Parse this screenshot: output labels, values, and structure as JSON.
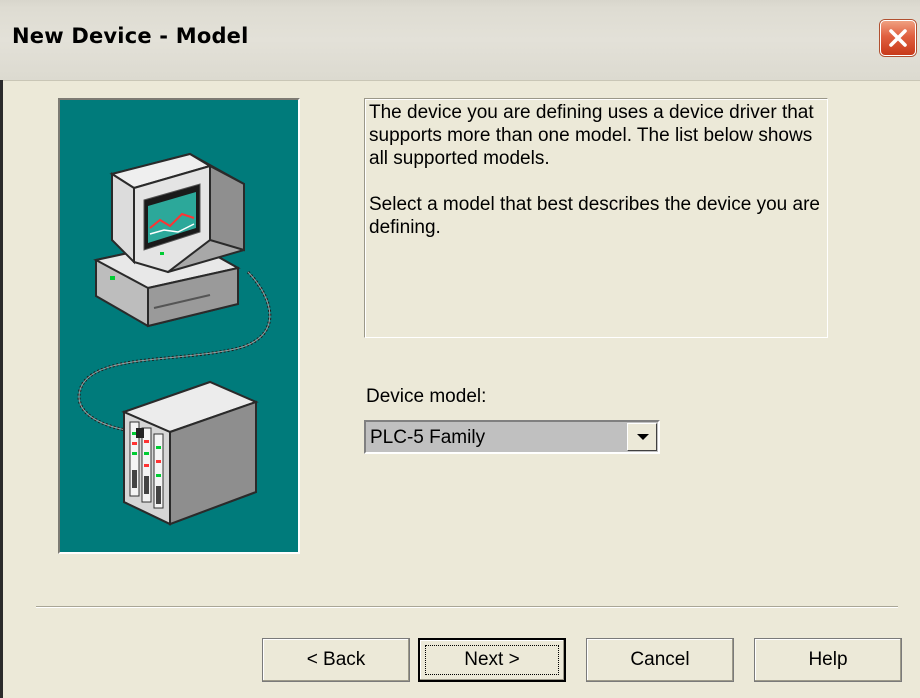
{
  "window": {
    "title": "New Device - Model"
  },
  "illustration": {
    "icon": "computer-to-plc-connection-illustration",
    "background": "#007b7b"
  },
  "info": {
    "paragraph1": "The device you are defining uses a device driver that supports more than one model.  The list below shows all supported models.",
    "paragraph2": "Select  a model that best describes the device you are defining."
  },
  "model": {
    "label": "Device model:",
    "selected": "PLC-5 Family"
  },
  "buttons": {
    "back": "< Back",
    "next": "Next >",
    "cancel": "Cancel",
    "help": "Help"
  }
}
